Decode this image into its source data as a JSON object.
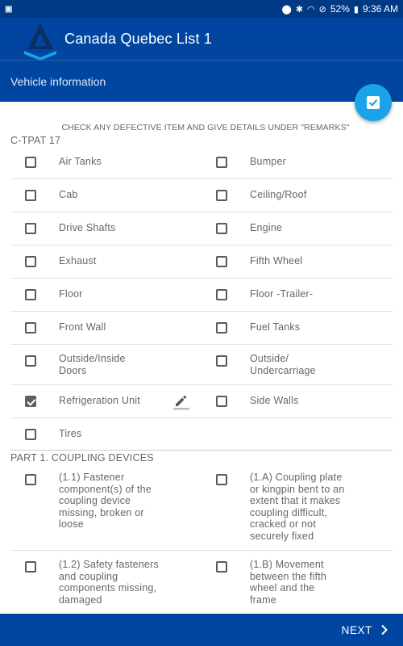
{
  "status_bar": {
    "left_icon": "notification-icon",
    "battery": "52%",
    "time": "9:36 AM"
  },
  "app_bar": {
    "title": "Canada Quebec List 1",
    "logo": "app-logo"
  },
  "sub_bar": {
    "title": "Vehicle information"
  },
  "fab": {
    "icon": "checkbox-check-icon"
  },
  "instruction": "CHECK ANY DEFECTIVE ITEM AND GIVE DETAILS UNDER \"REMARKS\"",
  "sections": [
    {
      "title": "C-TPAT 17",
      "rows": [
        {
          "left": {
            "label": "Air Tanks",
            "checked": false
          },
          "right": {
            "label": "Bumper",
            "checked": false
          }
        },
        {
          "left": {
            "label": "Cab",
            "checked": false
          },
          "right": {
            "label": "Ceiling/Roof",
            "checked": false
          }
        },
        {
          "left": {
            "label": "Drive Shafts",
            "checked": false
          },
          "right": {
            "label": "Engine",
            "checked": false
          }
        },
        {
          "left": {
            "label": "Exhaust",
            "checked": false
          },
          "right": {
            "label": "Fifth Wheel",
            "checked": false
          }
        },
        {
          "left": {
            "label": "Floor",
            "checked": false
          },
          "right": {
            "label": "Floor -Trailer-",
            "checked": false
          }
        },
        {
          "left": {
            "label": "Front Wall",
            "checked": false
          },
          "right": {
            "label": "Fuel Tanks",
            "checked": false
          }
        },
        {
          "left": {
            "label": "Outside/Inside Doors",
            "checked": false
          },
          "right": {
            "label": "Outside/ Undercarriage",
            "checked": false
          }
        },
        {
          "left": {
            "label": "Refrigeration Unit",
            "checked": true,
            "edit_icon": "pencil-icon"
          },
          "right": {
            "label": "Side Walls",
            "checked": false
          }
        },
        {
          "left": {
            "label": "Tires",
            "checked": false
          }
        }
      ]
    },
    {
      "title": "PART 1. COUPLING DEVICES",
      "rows": [
        {
          "left": {
            "label": "(1.1) Fastener component(s) of the coupling device missing, broken or loose",
            "checked": false
          },
          "right": {
            "label": "(1.A) Coupling plate or kingpin bent to an extent that it makes coupling difficult, cracked or not securely fixed",
            "checked": false
          }
        },
        {
          "left": {
            "label": "(1.2) Safety fasteners and coupling components missing, damaged",
            "checked": false
          },
          "right": {
            "label": "(1.B) Movement between the fifth wheel and the frame",
            "checked": false
          }
        }
      ]
    }
  ],
  "bottom_bar": {
    "next_label": "NEXT"
  },
  "colors": {
    "primary": "#0046a0",
    "status_bar": "#003a84",
    "fab": "#1ba3ea"
  }
}
